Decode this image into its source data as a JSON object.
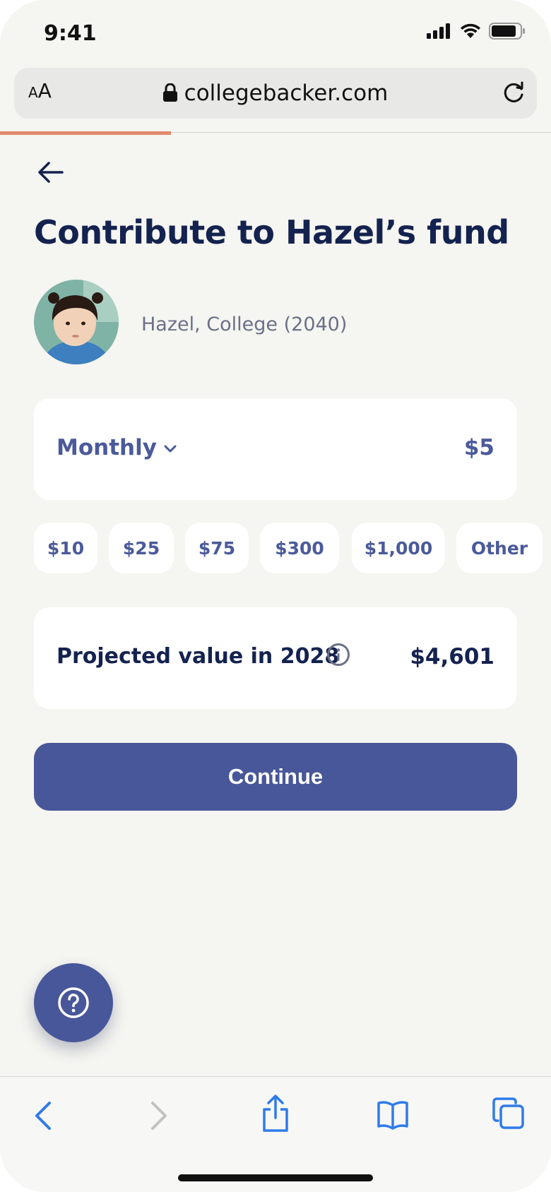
{
  "status": {
    "time": "9:41"
  },
  "browser": {
    "text_size_label_small": "A",
    "text_size_label_large": "A",
    "url": "collegebacker.com"
  },
  "page": {
    "title": "Contribute to Hazel’s fund",
    "child_label": "Hazel, College (2040)",
    "frequency": "Monthly",
    "amount": "$5",
    "presets": [
      "$10",
      "$25",
      "$75",
      "$300",
      "$1,000",
      "Other"
    ],
    "projection_label": "Projected value in 2028",
    "projection_value": "$4,601",
    "continue_label": "Continue",
    "progress_fraction": 0.31
  },
  "colors": {
    "primary": "#485799",
    "heading": "#14224f",
    "accent_progress": "#e08a6a",
    "background": "#f5f5f1"
  },
  "icons": [
    "signal-icon",
    "wifi-icon",
    "battery-icon",
    "lock-icon",
    "reload-icon",
    "back-arrow-icon",
    "chevron-down-icon",
    "info-icon",
    "help-icon",
    "browser-back-icon",
    "browser-forward-icon",
    "share-icon",
    "bookmarks-icon",
    "tabs-icon"
  ]
}
